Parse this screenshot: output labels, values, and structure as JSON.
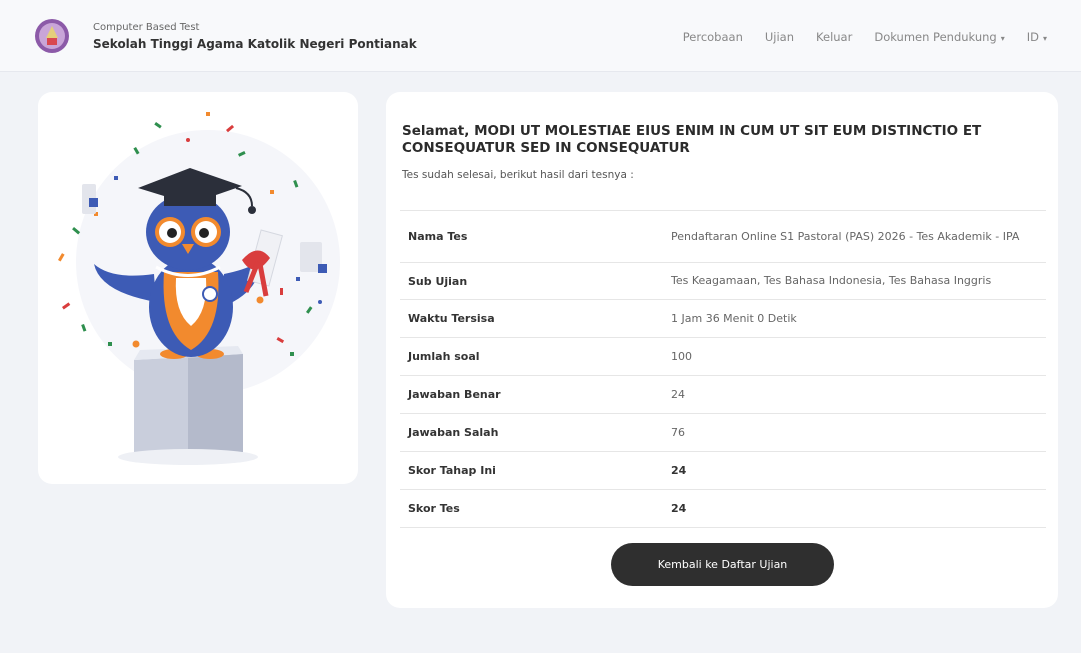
{
  "brand": {
    "subtitle": "Computer Based Test",
    "title": "Sekolah Tinggi Agama Katolik Negeri Pontianak"
  },
  "nav": {
    "items": [
      {
        "label": "Percobaan"
      },
      {
        "label": "Ujian"
      },
      {
        "label": "Keluar"
      },
      {
        "label": "Dokumen Pendukung"
      },
      {
        "label": "ID"
      }
    ],
    "caret": "▾"
  },
  "result": {
    "greeting": "Selamat, MODI UT MOLESTIAE EIUS ENIM IN CUM UT SIT EUM DISTINCTIO ET CONSEQUATUR SED IN CONSEQUATUR",
    "subtitle": "Tes sudah selesai, berikut hasil dari tesnya :",
    "rows": [
      {
        "label": "Nama Tes",
        "value": "Pendaftaran Online S1 Pastoral (PAS) 2026 - Tes Akademik - IPA"
      },
      {
        "label": "Sub Ujian",
        "value": "Tes Keagamaan, Tes Bahasa Indonesia, Tes Bahasa Inggris"
      },
      {
        "label": "Waktu Tersisa",
        "value": "1 Jam 36 Menit 0 Detik"
      },
      {
        "label": "Jumlah soal",
        "value": "100"
      },
      {
        "label": "Jawaban Benar",
        "value": "24"
      },
      {
        "label": "Jawaban Salah",
        "value": "76"
      },
      {
        "label": "Skor Tahap Ini",
        "value": "24"
      },
      {
        "label": "Skor Tes",
        "value": "24"
      }
    ],
    "back_button": "Kembali ke Daftar Ujian"
  },
  "colors": {
    "page_bg": "#f1f3f7",
    "button_bg": "#2f2f2f",
    "owl_blue": "#3d5bb5",
    "owl_orange": "#f28a2e"
  }
}
